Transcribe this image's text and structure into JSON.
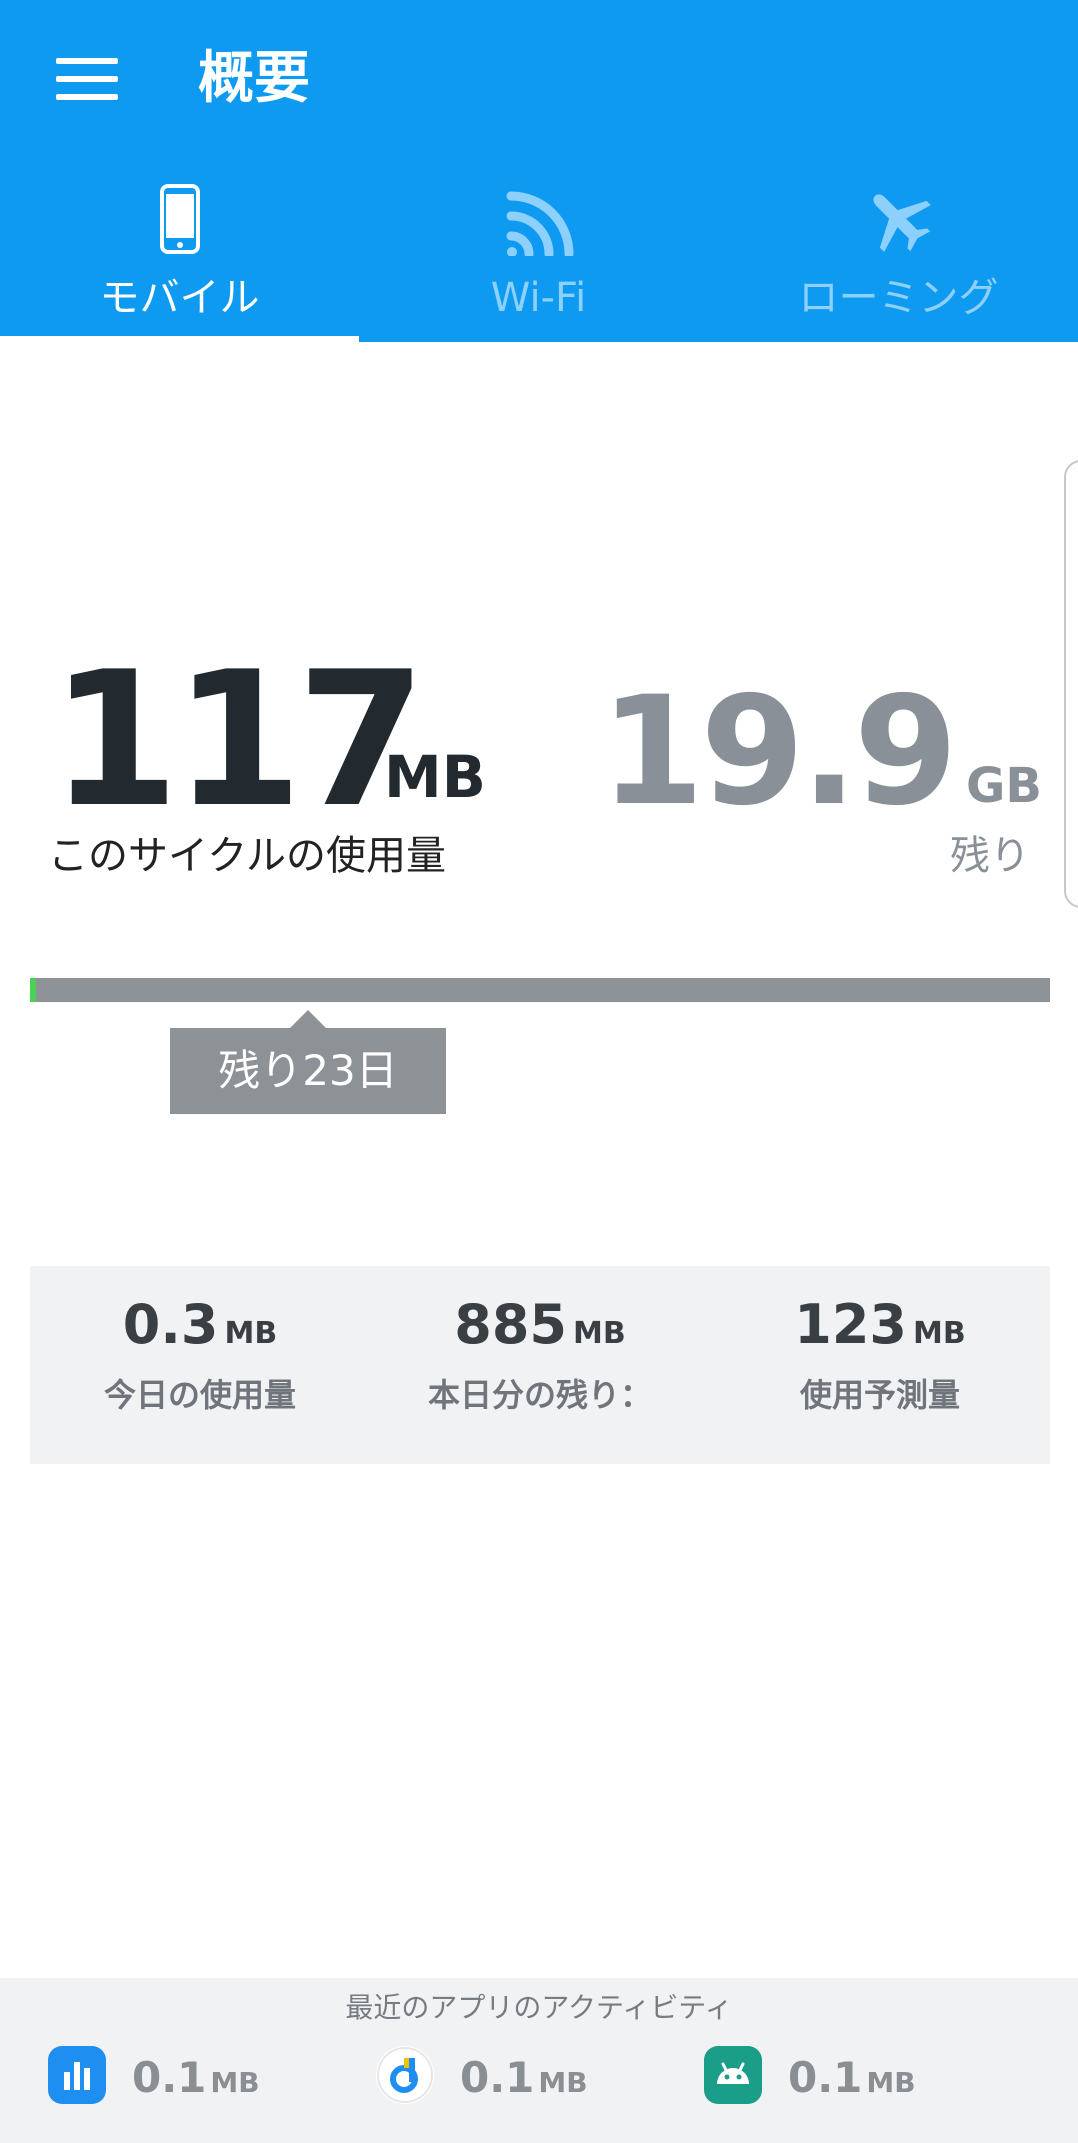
{
  "header": {
    "title": "概要"
  },
  "tabs": [
    {
      "label": "モバイル",
      "icon": "smartphone-icon",
      "active": true
    },
    {
      "label": "Wi-Fi",
      "icon": "wifi-icon",
      "active": false
    },
    {
      "label": "ローミング",
      "icon": "airplane-icon",
      "active": false
    }
  ],
  "usage": {
    "used_value": "117",
    "used_unit": "MB",
    "used_label": "このサイクルの使用量",
    "remaining_value": "19.9",
    "remaining_unit": "GB",
    "remaining_label": "残り",
    "cycle_progress": 0.006,
    "days_left": "残り23日"
  },
  "stats": [
    {
      "value": "0.3",
      "unit": "MB",
      "label": "今日の使用量"
    },
    {
      "value": "885",
      "unit": "MB",
      "label": "本日分の残り："
    },
    {
      "value": "123",
      "unit": "MB",
      "label": "使用予測量"
    }
  ],
  "activity": {
    "title": "最近のアプリのアクティビティ",
    "apps": [
      {
        "icon": "data-usage-app-icon",
        "value": "0.1",
        "unit": "MB"
      },
      {
        "icon": "circle-app-icon",
        "value": "0.1",
        "unit": "MB"
      },
      {
        "icon": "android-icon",
        "value": "0.1",
        "unit": "MB"
      }
    ]
  },
  "colors": {
    "primary": "#0f9af2",
    "progress_fill": "#4ccf55",
    "bar": "#8d9297"
  }
}
